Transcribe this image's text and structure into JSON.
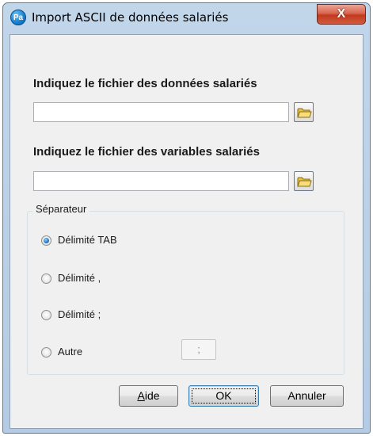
{
  "window": {
    "title": "Import ASCII de données salariés",
    "app_icon_text": "Pa",
    "close_symbol": "X"
  },
  "data_file": {
    "label": "Indiquez le fichier des données salariés",
    "value": "",
    "browse_icon": "folder-icon"
  },
  "variables_file": {
    "label": "Indiquez le fichier des variables salariés",
    "value": "",
    "browse_icon": "folder-icon"
  },
  "separator": {
    "group_label": "Séparateur",
    "options": [
      {
        "label": "Délimité TAB",
        "checked": true
      },
      {
        "label": "Délimité ,",
        "checked": false
      },
      {
        "label": "Délimité ;",
        "checked": false
      },
      {
        "label": "Autre",
        "checked": false
      }
    ],
    "other_value": ";"
  },
  "buttons": {
    "help_accel": "A",
    "help_rest": "ide",
    "ok": "OK",
    "cancel": "Annuler"
  },
  "colors": {
    "frame": "#b4cbe3",
    "close_button": "#c03a1f",
    "client": "#f0f0f0"
  }
}
